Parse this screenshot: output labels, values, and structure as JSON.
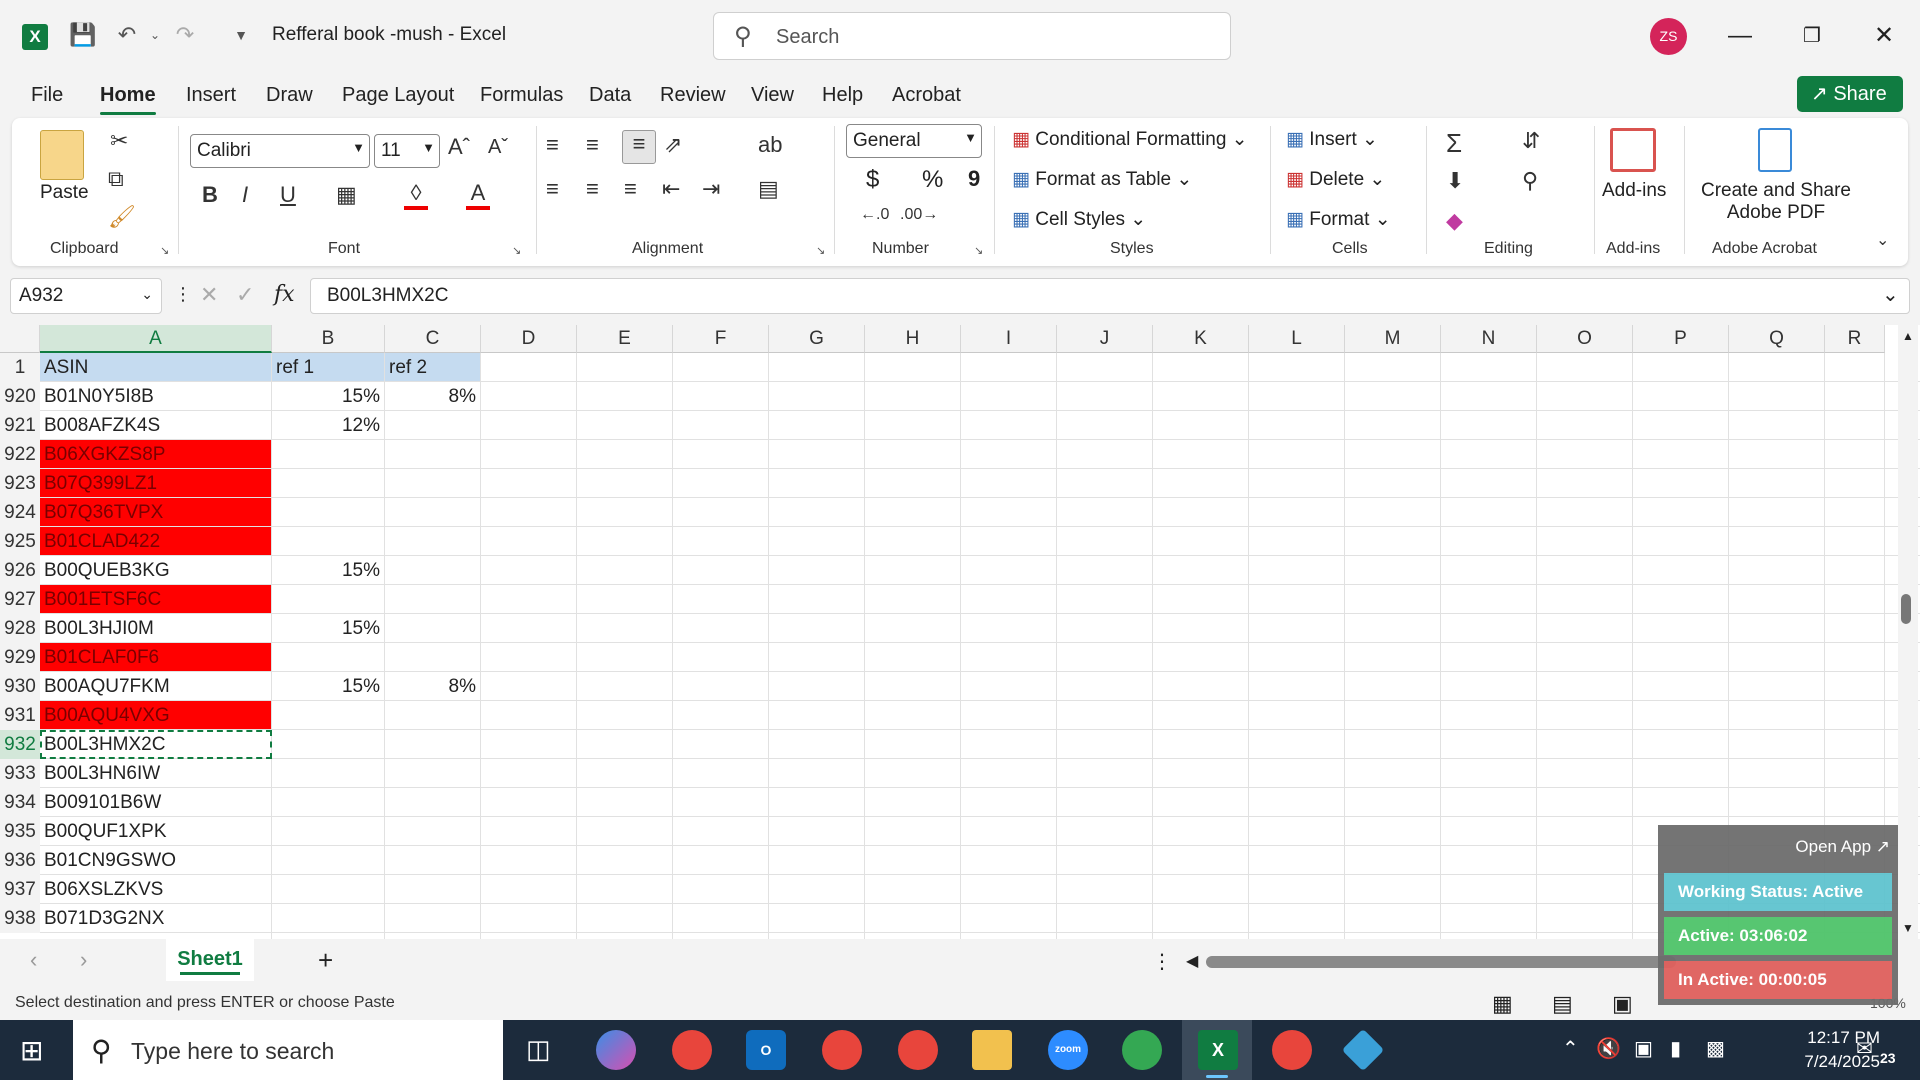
{
  "window": {
    "title": "Refferal book -mush  -  Excel",
    "search_placeholder": "Search",
    "avatar_initials": "ZS"
  },
  "menu": {
    "tabs": [
      "File",
      "Home",
      "Insert",
      "Draw",
      "Page Layout",
      "Formulas",
      "Data",
      "Review",
      "View",
      "Help",
      "Acrobat"
    ],
    "active": "Home",
    "share_label": "Share"
  },
  "ribbon": {
    "clipboard": {
      "paste": "Paste",
      "label": "Clipboard"
    },
    "font": {
      "family": "Calibri",
      "size": "11",
      "label": "Font"
    },
    "alignment": {
      "label": "Alignment"
    },
    "number": {
      "format": "General",
      "currency": "$",
      "percent": "%",
      "comma": "9",
      "label": "Number"
    },
    "styles": {
      "conditional": "Conditional Formatting",
      "format_table": "Format as Table",
      "cell_styles": "Cell Styles",
      "label": "Styles"
    },
    "cells": {
      "insert": "Insert",
      "delete": "Delete",
      "format": "Format",
      "label": "Cells"
    },
    "editing": {
      "label": "Editing"
    },
    "addins": {
      "button": "Add-ins",
      "label": "Add-ins"
    },
    "acrobat": {
      "button_line1": "Create and Share",
      "button_line2": "Adobe PDF",
      "label": "Adobe Acrobat"
    }
  },
  "formula_bar": {
    "name_box": "A932",
    "fx": "fx",
    "content": "B00L3HMX2C"
  },
  "grid": {
    "columns": [
      "A",
      "B",
      "C",
      "D",
      "E",
      "F",
      "G",
      "H",
      "I",
      "J",
      "K",
      "L",
      "M",
      "N",
      "O",
      "P",
      "Q",
      "R"
    ],
    "header_row": {
      "num": "1",
      "a": "ASIN",
      "b": "ref 1",
      "c": "ref 2"
    },
    "rows": [
      {
        "num": "920",
        "a": "B01N0Y5I8B",
        "b": "15%",
        "c": "8%",
        "red": false
      },
      {
        "num": "921",
        "a": "B008AFZK4S",
        "b": "12%",
        "c": "",
        "red": false
      },
      {
        "num": "922",
        "a": "B06XGKZS8P",
        "b": "",
        "c": "",
        "red": true
      },
      {
        "num": "923",
        "a": "B07Q399LZ1",
        "b": "",
        "c": "",
        "red": true
      },
      {
        "num": "924",
        "a": "B07Q36TVPX",
        "b": "",
        "c": "",
        "red": true
      },
      {
        "num": "925",
        "a": "B01CLAD422",
        "b": "",
        "c": "",
        "red": true
      },
      {
        "num": "926",
        "a": "B00QUEB3KG",
        "b": "15%",
        "c": "",
        "red": false
      },
      {
        "num": "927",
        "a": "B001ETSF6C",
        "b": "",
        "c": "",
        "red": true
      },
      {
        "num": "928",
        "a": "B00L3HJI0M",
        "b": "15%",
        "c": "",
        "red": false
      },
      {
        "num": "929",
        "a": "B01CLAF0F6",
        "b": "",
        "c": "",
        "red": true
      },
      {
        "num": "930",
        "a": "B00AQU7FKM",
        "b": "15%",
        "c": "8%",
        "red": false
      },
      {
        "num": "931",
        "a": "B00AQU4VXG",
        "b": "",
        "c": "",
        "red": true
      },
      {
        "num": "932",
        "a": "B00L3HMX2C",
        "b": "",
        "c": "",
        "red": false
      },
      {
        "num": "933",
        "a": "B00L3HN6IW",
        "b": "",
        "c": "",
        "red": false
      },
      {
        "num": "934",
        "a": "B009101B6W",
        "b": "",
        "c": "",
        "red": false
      },
      {
        "num": "935",
        "a": "B00QUF1XPK",
        "b": "",
        "c": "",
        "red": false
      },
      {
        "num": "936",
        "a": "B01CN9GSWO",
        "b": "",
        "c": "",
        "red": false
      },
      {
        "num": "937",
        "a": "B06XSLZKVS",
        "b": "",
        "c": "",
        "red": false
      },
      {
        "num": "938",
        "a": "B071D3G2NX",
        "b": "",
        "c": "",
        "red": false
      }
    ],
    "selected_row": "932"
  },
  "sheets": {
    "active": "Sheet1",
    "add": "+"
  },
  "status": {
    "message": "Select destination and press ENTER or choose Paste",
    "zoom": "100%"
  },
  "widget": {
    "open_app": "Open App ↗",
    "working_status": "Working Status: Active",
    "active": "Active: 03:06:02",
    "inactive": "In Active: 00:00:05",
    "colors": {
      "working": "#5fc3cf",
      "active": "#4fc46a",
      "inactive": "#e0605d"
    }
  },
  "taskbar": {
    "search_placeholder": "Type here to search",
    "time": "12:17 PM",
    "date": "7/24/2025",
    "notif_count": "23",
    "zoom_label": "zoom"
  }
}
